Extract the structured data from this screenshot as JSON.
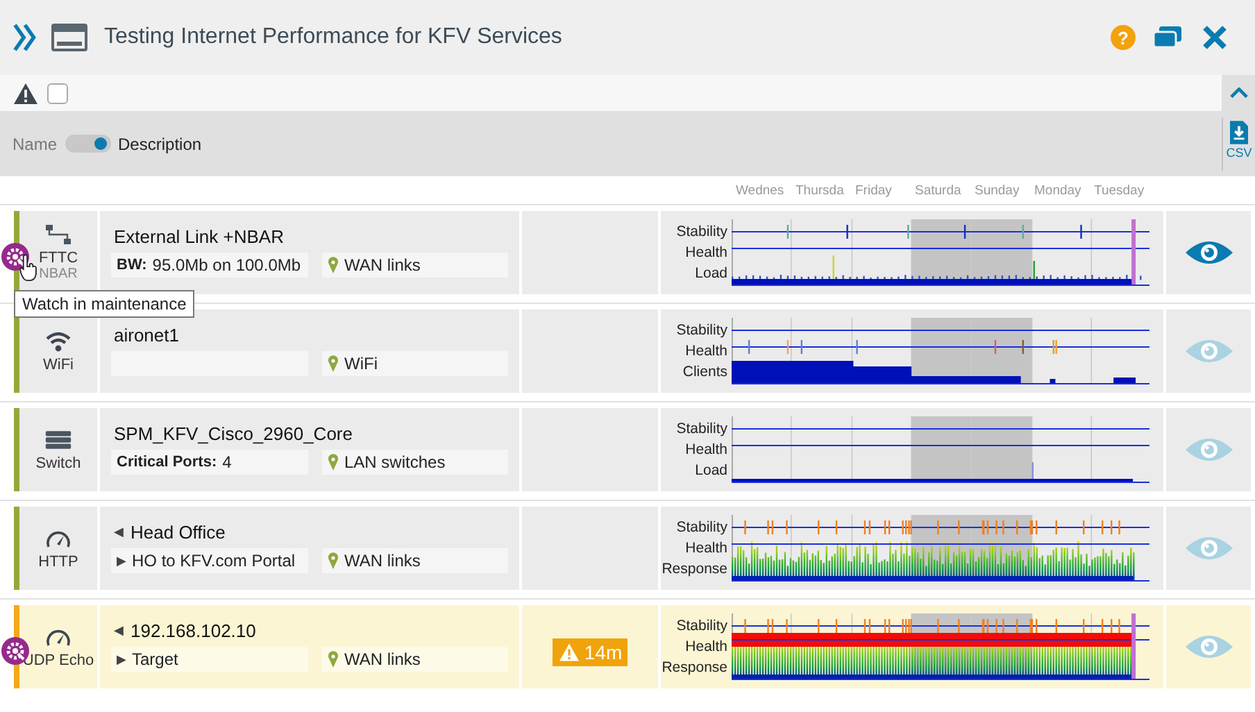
{
  "header": {
    "title": "Testing Internet Performance for KFV Services",
    "help_label": "?"
  },
  "toolbar": {
    "alerts_only": false
  },
  "filter": {
    "left_label": "Name",
    "right_label": "Description",
    "right_selected": true,
    "export_label": "CSV"
  },
  "days": [
    "Wednes",
    "Thursda",
    "Friday",
    "Saturda",
    "Sunday",
    "Monday",
    "Tuesday"
  ],
  "rows": [
    {
      "type": "FTTC",
      "subtype": "NBAR",
      "kind": "link",
      "name": "External Link +NBAR",
      "detail_label": "BW:",
      "detail": "95.0Mb on 100.0Mb",
      "group": "WAN links",
      "alarm": false,
      "maintenance": true,
      "tooltip": "Watch in maintenance",
      "watching": true,
      "chart": {
        "kind": "load",
        "labels": [
          "Stability",
          "Health",
          "Load"
        ]
      }
    },
    {
      "type": "WiFi",
      "kind": "wifi",
      "name": "aironet1",
      "group": "WiFi",
      "alarm": false,
      "maintenance": false,
      "watching": false,
      "chart": {
        "kind": "clients",
        "labels": [
          "Stability",
          "Health",
          "Clients"
        ]
      }
    },
    {
      "type": "Switch",
      "kind": "switch",
      "name": "SPM_KFV_Cisco_2960_Core",
      "detail_label": "Critical Ports:",
      "detail": "4",
      "group": "LAN switches",
      "alarm": false,
      "maintenance": false,
      "watching": false,
      "chart": {
        "kind": "flat",
        "labels": [
          "Stability",
          "Health",
          "Load"
        ]
      }
    },
    {
      "type": "HTTP",
      "kind": "gauge",
      "name_marker": "◀",
      "name": "Head Office",
      "detail": "HO to KFV.com Portal",
      "detail_marker": "▶",
      "group": "WAN links",
      "alarm": false,
      "maintenance": false,
      "watching": false,
      "chart": {
        "kind": "response",
        "labels": [
          "Stability",
          "Health",
          "Response"
        ]
      }
    },
    {
      "type": "UDP Echo",
      "kind": "gauge",
      "name_marker": "◀",
      "name": "192.168.102.10",
      "detail": "Target",
      "detail_marker": "▶",
      "group": "WAN links",
      "alarm": true,
      "maintenance": true,
      "alert": "14m",
      "watching": false,
      "chart": {
        "kind": "down",
        "labels": [
          "Stability",
          "Health",
          "Response"
        ]
      }
    }
  ]
}
